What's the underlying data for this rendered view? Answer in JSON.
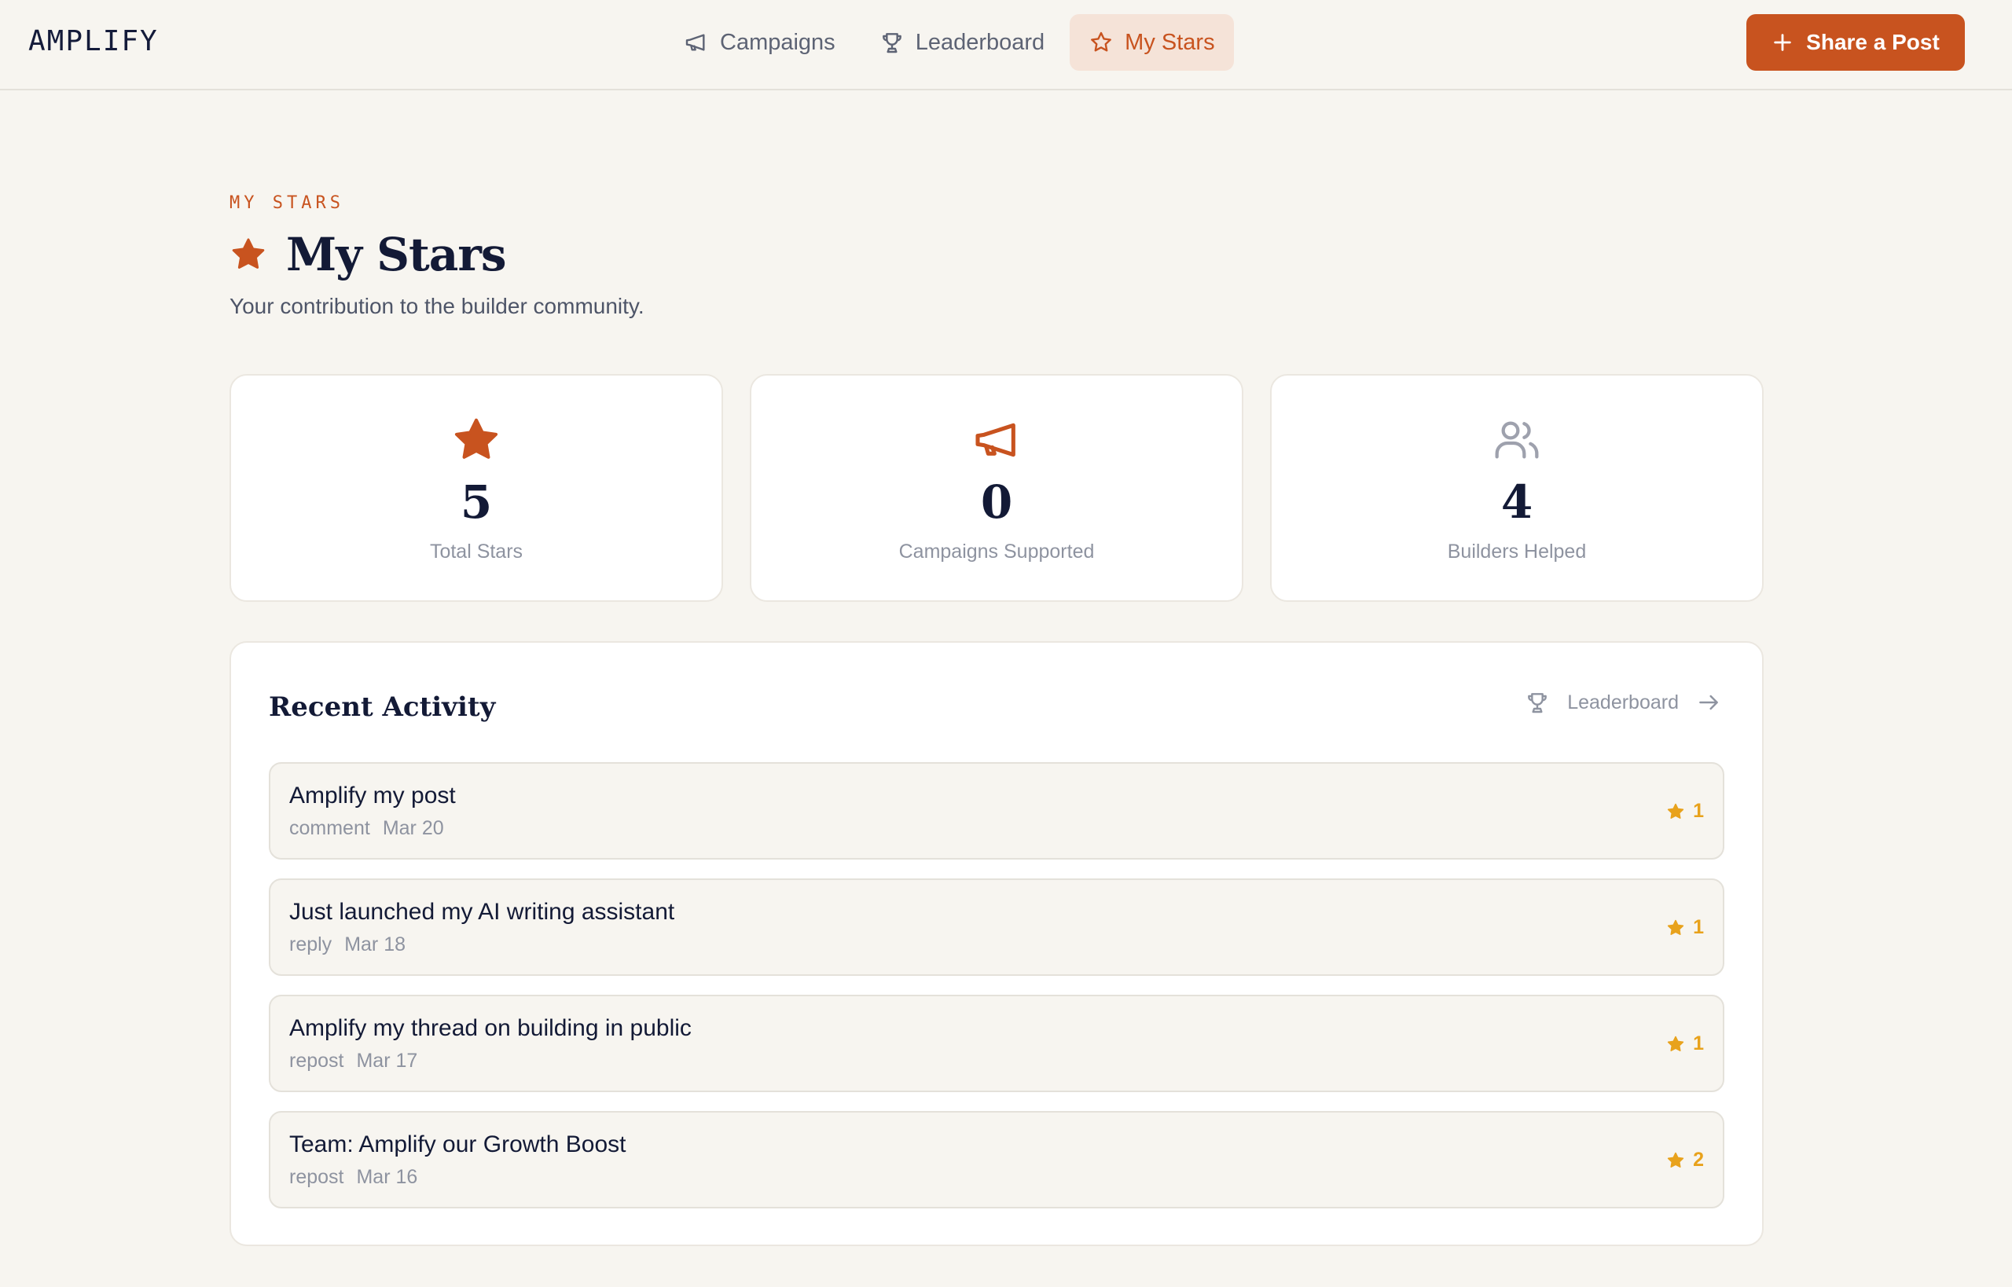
{
  "app": {
    "logo": "AMPLIFY"
  },
  "nav": {
    "items": [
      {
        "label": "Campaigns",
        "icon": "megaphone-icon"
      },
      {
        "label": "Leaderboard",
        "icon": "trophy-icon"
      },
      {
        "label": "My Stars",
        "icon": "star-icon",
        "active": true
      }
    ],
    "cta_label": "Share a Post"
  },
  "page": {
    "eyebrow": "MY STARS",
    "title": "My Stars",
    "subtitle": "Your contribution to the builder community."
  },
  "stats": [
    {
      "value": "5",
      "label": "Total Stars",
      "icon": "star-icon"
    },
    {
      "value": "0",
      "label": "Campaigns Supported",
      "icon": "megaphone-icon"
    },
    {
      "value": "4",
      "label": "Builders Helped",
      "icon": "users-icon"
    }
  ],
  "activity": {
    "title": "Recent Activity",
    "link_label": "Leaderboard",
    "items": [
      {
        "title": "Amplify my post",
        "type": "comment",
        "date": "Mar 20",
        "stars": "1"
      },
      {
        "title": "Just launched my AI writing assistant",
        "type": "reply",
        "date": "Mar 18",
        "stars": "1"
      },
      {
        "title": "Amplify my thread on building in public",
        "type": "repost",
        "date": "Mar 17",
        "stars": "1"
      },
      {
        "title": "Team: Amplify our Growth Boost",
        "type": "repost",
        "date": "Mar 16",
        "stars": "2"
      }
    ]
  },
  "colors": {
    "accent": "#c8531f",
    "accent_soft": "#f5e3d8",
    "star_gold": "#e8a21c",
    "background": "#f7f5f0",
    "text_dark": "#131a36",
    "text_muted": "#8e93a0"
  }
}
